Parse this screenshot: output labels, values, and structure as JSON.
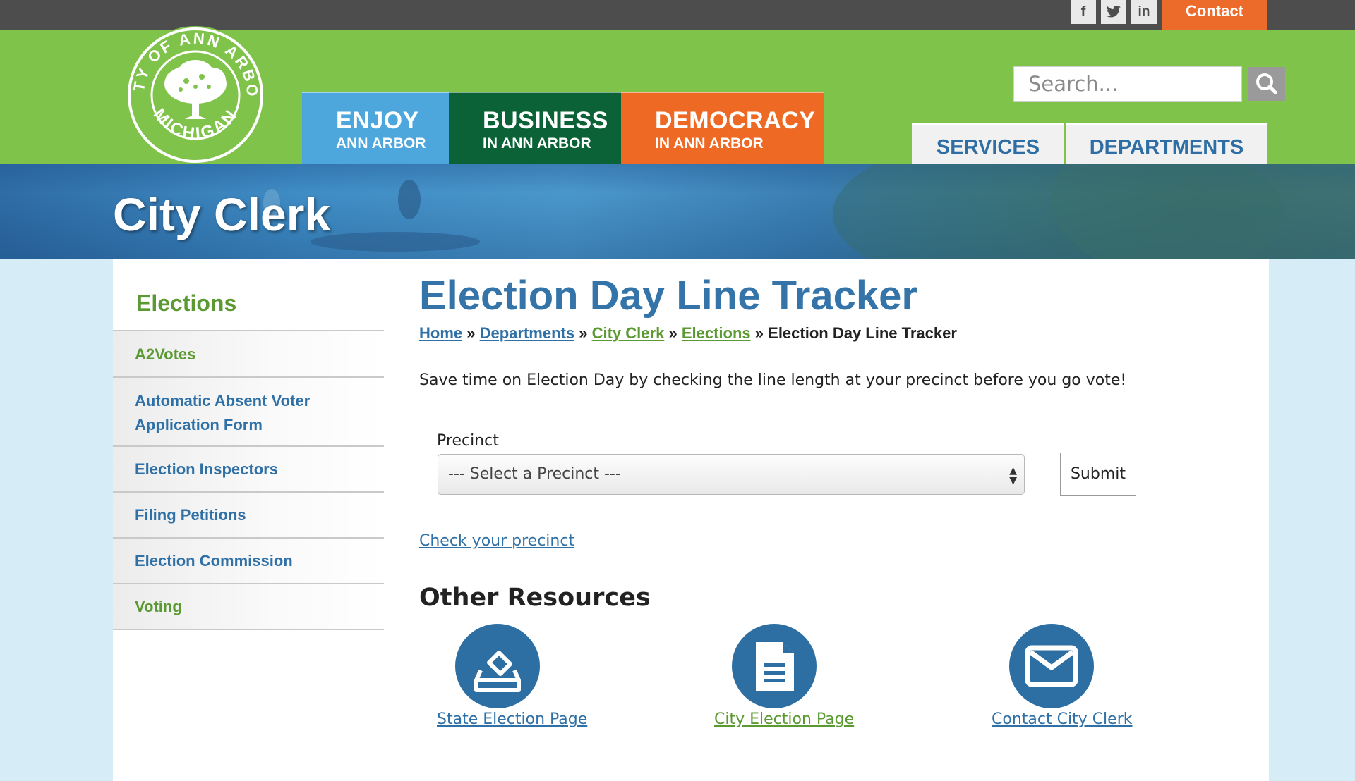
{
  "topbar": {
    "social": [
      {
        "name": "facebook",
        "glyph": "f"
      },
      {
        "name": "twitter",
        "glyph": "t"
      },
      {
        "name": "linkedin",
        "glyph": "in"
      }
    ],
    "contact_label": "Contact"
  },
  "logo": {
    "top_text": "CITY OF ANN ARBOR",
    "bottom_text": "MICHIGAN",
    "icon": "tree-seal-icon"
  },
  "nav": {
    "enjoy": {
      "big": "ENJOY",
      "small": "ANN ARBOR",
      "color": "#4ea7dc"
    },
    "business": {
      "big": "BUSINESS",
      "small": "IN ANN ARBOR",
      "color": "#0a6236"
    },
    "democracy": {
      "big": "DEMOCRACY",
      "small": "IN ANN ARBOR",
      "color": "#ee6a24"
    }
  },
  "search": {
    "placeholder": "Search...",
    "icon": "search-icon"
  },
  "tabs": {
    "services": "SERVICES",
    "departments": "DEPARTMENTS"
  },
  "banner": {
    "title": "City Clerk"
  },
  "sidebar": {
    "title": "Elections",
    "items": [
      {
        "label": "A2Votes",
        "color": "green"
      },
      {
        "label": "Automatic Absent Voter Application Form",
        "color": "blue"
      },
      {
        "label": "Election Inspectors",
        "color": "blue"
      },
      {
        "label": "Filing Petitions",
        "color": "blue"
      },
      {
        "label": "Election Commission",
        "color": "blue"
      },
      {
        "label": "Voting",
        "color": "green"
      }
    ]
  },
  "main": {
    "title": "Election Day Line Tracker",
    "breadcrumbs": [
      {
        "label": "Home",
        "link": true
      },
      {
        "label": "Departments",
        "link": true
      },
      {
        "label": "City Clerk",
        "link": true
      },
      {
        "label": "Elections",
        "link": true
      },
      {
        "label": "Election Day Line Tracker",
        "link": false
      }
    ],
    "breadcrumb_sep": "»",
    "intro": "Save time on Election Day by checking the line length at your precinct before you go vote!",
    "precinct_label": "Precinct",
    "precinct_selected": "--- Select a Precinct ---",
    "submit_label": "Submit",
    "check_link": "Check your precinct",
    "other_resources": "Other Resources",
    "resources": [
      {
        "label": "State Election Page",
        "icon": "ballot-box-icon"
      },
      {
        "label": "City Election Page",
        "icon": "document-icon"
      },
      {
        "label": "Contact City Clerk",
        "icon": "envelope-icon"
      }
    ]
  },
  "colors": {
    "header_green": "#7fc34a",
    "topbar_gray": "#4d4d4d",
    "contact_orange": "#ec6a2a",
    "link_blue": "#2f70a6",
    "link_green": "#5b9a32",
    "resource_circle": "#2d6fa3"
  }
}
